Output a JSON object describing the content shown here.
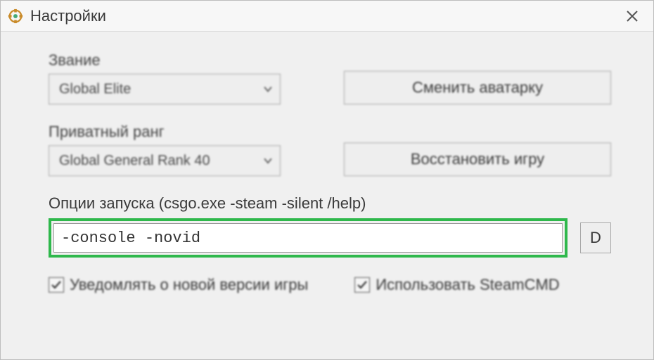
{
  "window": {
    "title": "Настройки"
  },
  "rank": {
    "label": "Звание",
    "value": "Global Elite"
  },
  "private_rank": {
    "label": "Приватный ранг",
    "value": "Global General Rank 40"
  },
  "buttons": {
    "change_avatar": "Сменить аватарку",
    "restore_game": "Восстановить игру",
    "d": "D"
  },
  "launch": {
    "label": "Опции запуска (csgo.exe -steam -silent /help)",
    "value": "-console -novid"
  },
  "checks": {
    "notify_update": "Уведомлять о новой версии игры",
    "use_steamcmd": "Использовать SteamCMD"
  }
}
